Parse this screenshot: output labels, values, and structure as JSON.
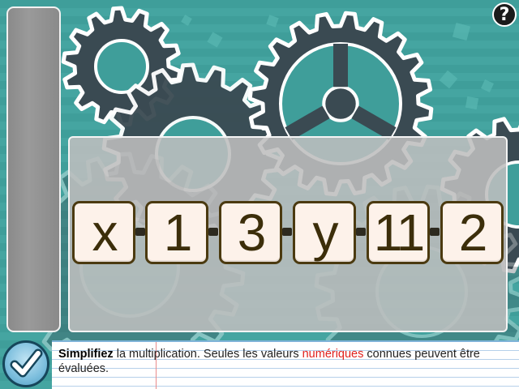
{
  "help": {
    "label": "?"
  },
  "expression": {
    "tiles": [
      "x",
      "1",
      "3",
      "y",
      "11",
      "2"
    ],
    "connector": "multiplication-dot"
  },
  "instruction": {
    "part1": "Simplifiez",
    "part2": " la multiplication. Seules les valeurs ",
    "part3": "numériques",
    "part4": " connues peuvent être évaluées."
  },
  "colors": {
    "background": "#3f9e9a",
    "gear": "#3a4a52",
    "tile_fill": "#fdf2ea",
    "tile_border": "#4b3a10",
    "highlight_red": "#e0211d",
    "check_button": "#7cbedd"
  },
  "icons": {
    "check": "check-icon",
    "help": "question-icon",
    "gears": "gear-icon"
  }
}
